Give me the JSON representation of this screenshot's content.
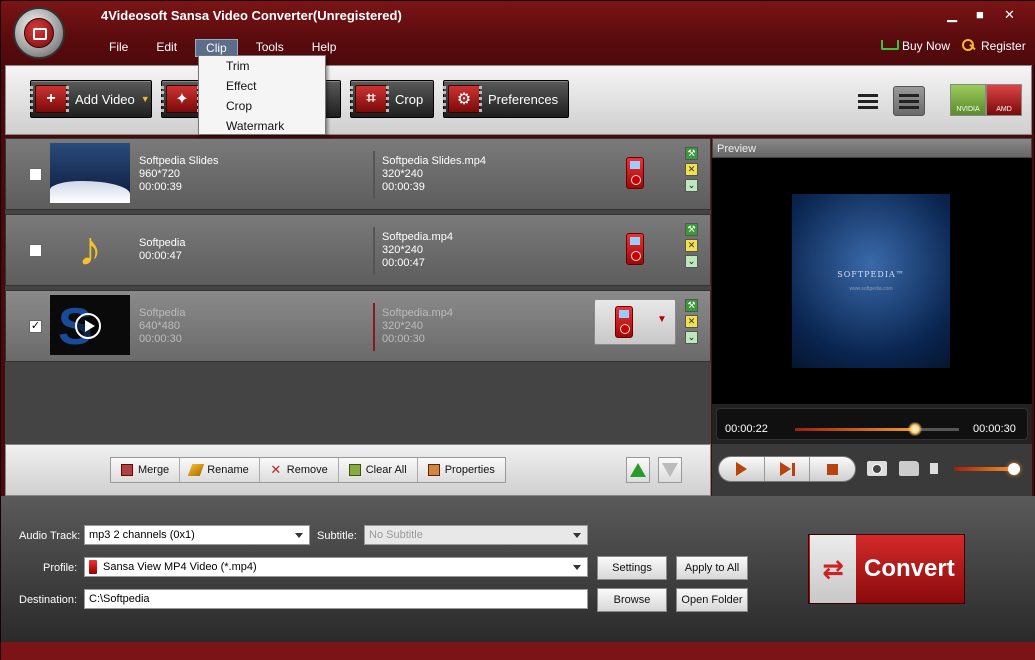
{
  "window": {
    "title": "4Videosoft Sansa Video Converter(Unregistered)",
    "minimize": "▁",
    "maximize": "■",
    "close": "✕"
  },
  "menu": {
    "items": [
      "File",
      "Edit",
      "Clip",
      "Tools",
      "Help"
    ],
    "active": "Clip",
    "buy_now": "Buy Now",
    "register": "Register"
  },
  "clip_menu": [
    "Trim",
    "Effect",
    "Crop",
    "Watermark"
  ],
  "toolbar": {
    "add_video": "Add Video",
    "crop": "Crop",
    "preferences": "Preferences",
    "nvidia": "NVIDIA",
    "amd": "AMD"
  },
  "files": [
    {
      "name": "Softpedia Slides",
      "resolution": "960*720",
      "duration": "00:00:39",
      "out_name": "Softpedia Slides.mp4",
      "out_res": "320*240",
      "out_dur": "00:00:39",
      "checked": false
    },
    {
      "name": "Softpedia",
      "resolution": "",
      "duration": "00:00:47",
      "out_name": "Softpedia.mp4",
      "out_res": "320*240",
      "out_dur": "00:00:47",
      "checked": false
    },
    {
      "name": "Softpedia",
      "resolution": "640*480",
      "duration": "00:00:30",
      "out_name": "Softpedia.mp4",
      "out_res": "320*240",
      "out_dur": "00:00:30",
      "checked": true
    }
  ],
  "list_actions": {
    "merge": "Merge",
    "rename": "Rename",
    "remove": "Remove",
    "clear_all": "Clear All",
    "properties": "Properties"
  },
  "preview": {
    "header": "Preview",
    "brand": "SOFTPEDIA™",
    "url": "www.softpedia.com",
    "current_time": "00:00:22",
    "total_time": "00:00:30",
    "progress": 0.73,
    "volume": 0.95
  },
  "settings": {
    "audio_track_label": "Audio Track:",
    "audio_track_value": "mp3 2 channels (0x1)",
    "subtitle_label": "Subtitle:",
    "subtitle_value": "No Subtitle",
    "profile_label": "Profile:",
    "profile_value": "Sansa View MP4 Video (*.mp4)",
    "destination_label": "Destination:",
    "destination_value": "C:\\Softpedia",
    "settings_btn": "Settings",
    "apply_all_btn": "Apply to All",
    "browse_btn": "Browse",
    "open_folder_btn": "Open Folder",
    "convert_btn": "Convert"
  },
  "colors": {
    "brand_red": "#7a1416",
    "accent_orange": "#f29a2c"
  }
}
